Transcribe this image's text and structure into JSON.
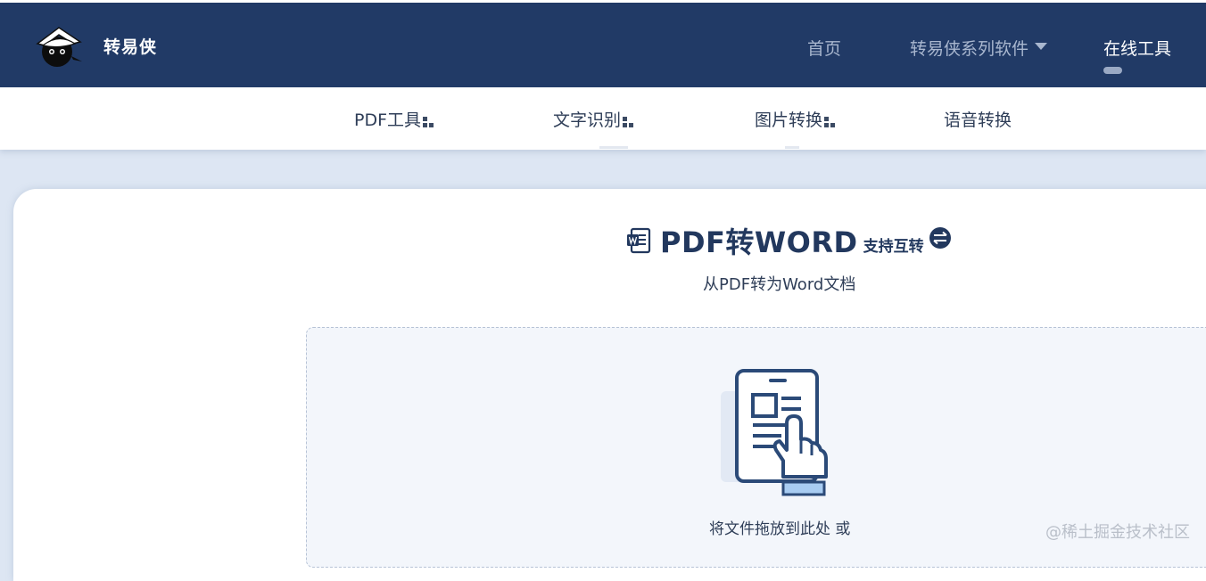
{
  "header": {
    "brand": "转易侠",
    "nav": [
      {
        "label": "首页"
      },
      {
        "label": "转易侠系列软件"
      },
      {
        "label": "在线工具"
      }
    ]
  },
  "subnav": {
    "items": [
      {
        "label": "PDF工具"
      },
      {
        "label": "文字识别"
      },
      {
        "label": "图片转换"
      },
      {
        "label": "语音转换"
      }
    ]
  },
  "main": {
    "title": "PDF转WORD",
    "title_suffix": "支持互转",
    "subtitle": "从PDF转为Word文档",
    "dropzone_text": "将文件拖放到此处 或"
  },
  "watermark": "@稀土掘金技术社区",
  "colors": {
    "header_bg": "#213a66",
    "accent": "#22385e",
    "page_bg": "#dde6f3",
    "dropzone_bg": "#f3f6fb"
  },
  "icons": [
    "logo-icon",
    "grid-icon",
    "word-doc-icon",
    "swap-icon",
    "tablet-touch-icon",
    "chevron-down-icon"
  ]
}
